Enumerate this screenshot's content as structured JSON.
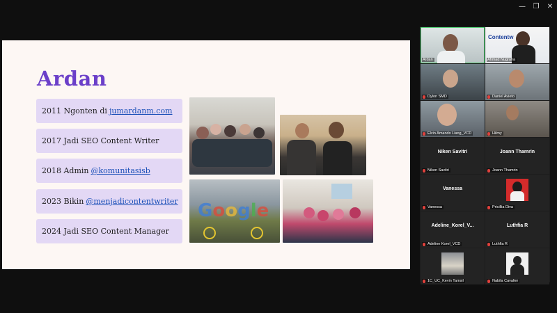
{
  "slide": {
    "title": "Ardan",
    "items": [
      {
        "text": "2011 Ngonten di",
        "link": "jumardanm.com"
      },
      {
        "text": "2017 Jadi SEO Content Writer",
        "link": ""
      },
      {
        "text": "2018 Admin",
        "link": "@komunitasisb"
      },
      {
        "text": "2023 Bikin",
        "link": "@menjadicontentwriter"
      },
      {
        "text": "2024 Jadi SEO Content Manager",
        "link": ""
      }
    ],
    "thumb_label": "Contentw"
  },
  "participants": [
    {
      "name": "Ardan",
      "centered": false
    },
    {
      "name": "Ahmad Nugraha",
      "centered": false
    },
    {
      "name": "Dylon SMD",
      "centered": false
    },
    {
      "name": "Daniel Avieto",
      "centered": false
    },
    {
      "name": "Elvin Amando Liang_VCD",
      "centered": false
    },
    {
      "name": "Hilmy",
      "centered": false
    },
    {
      "name": "Niken Savitri",
      "centered": true
    },
    {
      "name": "Joann Thamrin",
      "centered": true
    },
    {
      "name": "Vanessa",
      "centered": true
    },
    {
      "name": "Pricillia Diva",
      "centered": false
    },
    {
      "name": "Adeline_Korel_V...",
      "tag": "Adeline Korel_VCD",
      "centered": true
    },
    {
      "name": "Luthfia R",
      "centered": true
    },
    {
      "name": "1C_UC_Kevin Tamsil",
      "centered": false
    },
    {
      "name": "Nabila Cavalier",
      "centered": false
    }
  ],
  "colors": {
    "accent": "#6b3fc9",
    "link": "#1a4fb8",
    "item_bg": "#e3d8f5",
    "active": "#4ecb71",
    "mic_off": "#e0413c"
  },
  "icons": {
    "minimize": "minimize-icon",
    "restore": "restore-icon",
    "close": "close-icon",
    "mic": "mic-off-icon"
  }
}
